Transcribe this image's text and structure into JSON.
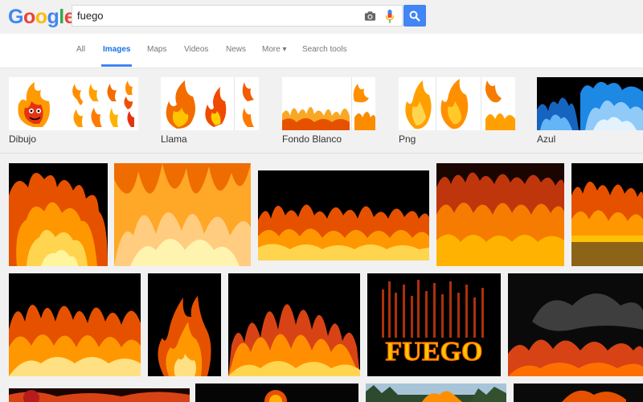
{
  "logo": {
    "letters": [
      "G",
      "o",
      "o",
      "g",
      "l",
      "e"
    ],
    "colors": [
      "#4285f4",
      "#ea4335",
      "#fbbc05",
      "#4285f4",
      "#34a853",
      "#ea4335"
    ]
  },
  "search": {
    "query": "fuego",
    "camera_icon": "camera-icon",
    "mic_icon": "microphone-icon",
    "button_icon": "search-icon",
    "button_color": "#4285f4"
  },
  "tabs": [
    {
      "label": "All"
    },
    {
      "label": "Images"
    },
    {
      "label": "Maps"
    },
    {
      "label": "Videos"
    },
    {
      "label": "News"
    },
    {
      "label": "More ▾"
    },
    {
      "label": "Search tools"
    }
  ],
  "related": [
    {
      "label": "Dibujo"
    },
    {
      "label": "Llama"
    },
    {
      "label": "Fondo Blanco"
    },
    {
      "label": "Png"
    },
    {
      "label": "Azul"
    }
  ],
  "results": {
    "text_overlay": "FUEGO"
  }
}
